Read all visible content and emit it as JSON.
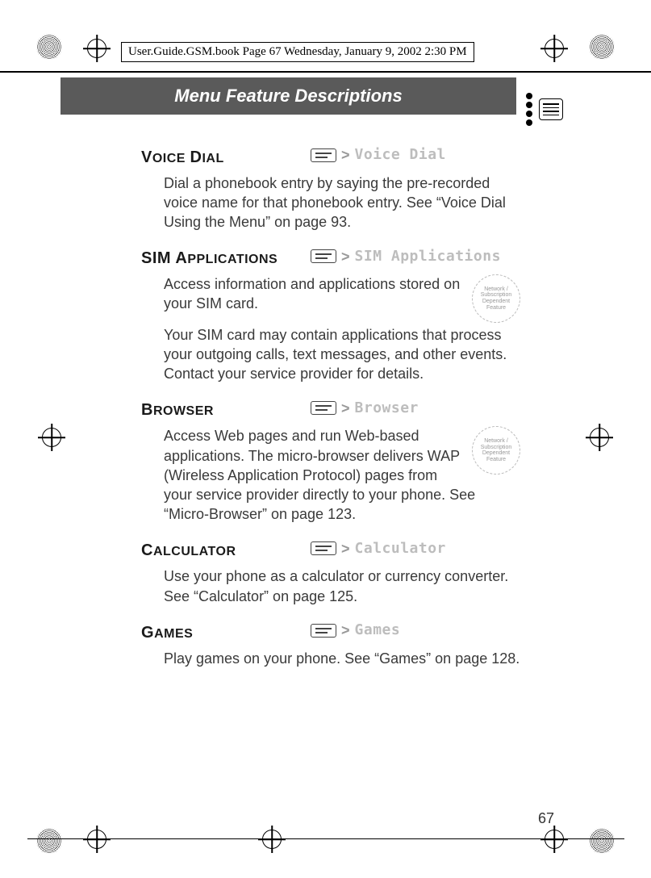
{
  "print_header": "User.Guide.GSM.book  Page 67  Wednesday, January 9, 2002  2:30 PM",
  "page_title": "Menu Feature Descriptions",
  "page_number": "67",
  "sections": [
    {
      "heading": "Voice Dial",
      "menu_label": "Voice Dial",
      "has_net_icon": false,
      "body": "Dial a phonebook entry by saying the pre-recorded voice name for that phonebook entry. See “Voice Dial Using the Menu” on page 93."
    },
    {
      "heading": "SIM Applications",
      "menu_label": "SIM Applications",
      "has_net_icon": true,
      "body": "Access information and applications stored on your SIM card.",
      "body2": "Your SIM card may contain applications that process your outgoing calls, text messages, and other events. Contact your service provider for details."
    },
    {
      "heading": "Browser",
      "menu_label": "Browser",
      "has_net_icon": true,
      "body": "Access Web pages and run Web-based applications. The micro-browser delivers WAP (Wireless Application Protocol) pages from your service provider directly to your phone. See “Micro-Browser” on page 123."
    },
    {
      "heading": "Calculator",
      "menu_label": "Calculator",
      "has_net_icon": false,
      "body": "Use your phone as a calculator or currency converter. See “Calculator” on page 125."
    },
    {
      "heading": "Games",
      "menu_label": "Games",
      "has_net_icon": false,
      "body": "Play games on your phone. See “Games” on page 128."
    }
  ],
  "net_icon_text": "Network / Subscription Dependent Feature"
}
